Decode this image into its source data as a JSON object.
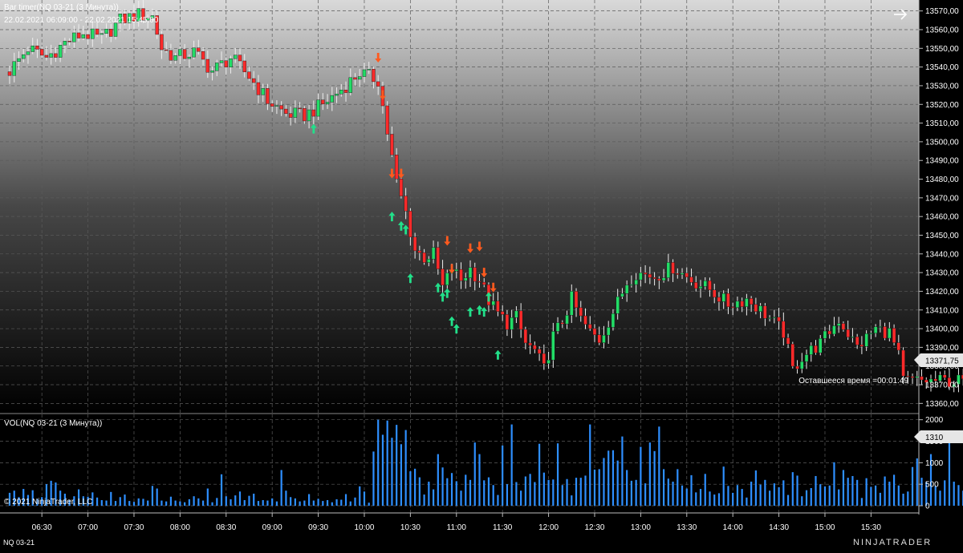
{
  "window": {
    "title": "Bar timer(NQ 03-21 (3 Минута))",
    "range": "22.02.2021 06:09:00 - 22.02.2021 15:45:00",
    "remaining_time": "Оставшееся время =00:01:49",
    "copyright": "© 2021 NinjaTrader, LLC",
    "instrument_tab": "NQ 03-21",
    "brand": "NINJATRADER",
    "colors": {
      "up": "#22dd66",
      "down": "#ff2a2a",
      "arrow_up": "#22e08a",
      "arrow_down": "#ff5a1e",
      "volume": "#2e8fff",
      "grid": "#5a5a5a"
    }
  },
  "chart_data": [
    {
      "type": "candlestick",
      "title": "Bar timer(NQ 03-21 (3 Минута))",
      "subtitle": "22.02.2021 06:09:00 - 22.02.2021 15:45:00",
      "ylim": [
        13355,
        13575
      ],
      "y_ticks": [
        "13570,00",
        "13560,00",
        "13550,00",
        "13540,00",
        "13530,00",
        "13520,00",
        "13510,00",
        "13500,00",
        "13490,00",
        "13480,00",
        "13470,00",
        "13460,00",
        "13450,00",
        "13440,00",
        "13430,00",
        "13420,00",
        "13410,00",
        "13400,00",
        "13390,00",
        "13380,00",
        "13370,00",
        "13360,00"
      ],
      "last_price_label": "13371,75",
      "last_price": 13371.75,
      "grid": true,
      "x_ticks": [
        "06:30",
        "07:00",
        "07:30",
        "08:00",
        "08:30",
        "09:00",
        "09:30",
        "10:00",
        "10:30",
        "11:00",
        "11:30",
        "12:00",
        "12:30",
        "13:00",
        "13:30",
        "14:00",
        "14:30",
        "15:00",
        "15:30"
      ],
      "x_tick_bars": [
        7,
        17,
        27,
        37,
        47,
        57,
        67,
        77,
        87,
        97,
        107,
        117,
        127,
        137,
        147,
        157,
        167,
        177,
        187
      ],
      "close_points": [
        [
          0,
          13538
        ],
        [
          4,
          13550
        ],
        [
          8,
          13545
        ],
        [
          12,
          13553
        ],
        [
          16,
          13558
        ],
        [
          20,
          13555
        ],
        [
          24,
          13565
        ],
        [
          28,
          13568
        ],
        [
          31,
          13567
        ],
        [
          33,
          13550
        ],
        [
          36,
          13545
        ],
        [
          40,
          13548
        ],
        [
          44,
          13538
        ],
        [
          48,
          13545
        ],
        [
          52,
          13535
        ],
        [
          56,
          13522
        ],
        [
          60,
          13515
        ],
        [
          64,
          13514
        ],
        [
          68,
          13520
        ],
        [
          72,
          13528
        ],
        [
          76,
          13537
        ],
        [
          80,
          13533
        ],
        [
          82,
          13505
        ],
        [
          84,
          13478
        ],
        [
          86,
          13462
        ],
        [
          88,
          13442
        ],
        [
          90,
          13438
        ],
        [
          92,
          13440
        ],
        [
          94,
          13422
        ],
        [
          96,
          13432
        ],
        [
          98,
          13426
        ],
        [
          100,
          13432
        ],
        [
          102,
          13426
        ],
        [
          104,
          13415
        ],
        [
          106,
          13408
        ],
        [
          108,
          13403
        ],
        [
          110,
          13406
        ],
        [
          112,
          13392
        ],
        [
          114,
          13388
        ],
        [
          116,
          13378
        ],
        [
          118,
          13396
        ],
        [
          120,
          13404
        ],
        [
          122,
          13416
        ],
        [
          124,
          13405
        ],
        [
          126,
          13398
        ],
        [
          128,
          13394
        ],
        [
          130,
          13404
        ],
        [
          132,
          13414
        ],
        [
          134,
          13425
        ],
        [
          136,
          13430
        ],
        [
          140,
          13428
        ],
        [
          144,
          13433
        ],
        [
          148,
          13426
        ],
        [
          152,
          13421
        ],
        [
          156,
          13413
        ],
        [
          160,
          13416
        ],
        [
          164,
          13408
        ],
        [
          168,
          13398
        ],
        [
          170,
          13378
        ],
        [
          172,
          13385
        ],
        [
          176,
          13392
        ],
        [
          180,
          13405
        ],
        [
          184,
          13390
        ],
        [
          188,
          13400
        ],
        [
          191,
          13398
        ],
        [
          193,
          13385
        ],
        [
          194,
          13372
        ]
      ],
      "signal_arrows": [
        {
          "type": "up",
          "bar": 66,
          "price": 13507
        },
        {
          "type": "down",
          "bar": 80,
          "price": 13545
        },
        {
          "type": "down",
          "bar": 81,
          "price": 13525
        },
        {
          "type": "down",
          "bar": 83,
          "price": 13483
        },
        {
          "type": "down",
          "bar": 85,
          "price": 13483
        },
        {
          "type": "up",
          "bar": 83,
          "price": 13460
        },
        {
          "type": "up",
          "bar": 85,
          "price": 13455
        },
        {
          "type": "up",
          "bar": 86,
          "price": 13453
        },
        {
          "type": "up",
          "bar": 87,
          "price": 13427
        },
        {
          "type": "down",
          "bar": 95,
          "price": 13447
        },
        {
          "type": "down",
          "bar": 96,
          "price": 13432
        },
        {
          "type": "up",
          "bar": 93,
          "price": 13422
        },
        {
          "type": "up",
          "bar": 96,
          "price": 13404
        },
        {
          "type": "up",
          "bar": 97,
          "price": 13400
        },
        {
          "type": "down",
          "bar": 100,
          "price": 13443
        },
        {
          "type": "down",
          "bar": 102,
          "price": 13444
        },
        {
          "type": "down",
          "bar": 103,
          "price": 13430
        },
        {
          "type": "down",
          "bar": 105,
          "price": 13422
        },
        {
          "type": "up",
          "bar": 100,
          "price": 13409
        },
        {
          "type": "up",
          "bar": 102,
          "price": 13410
        },
        {
          "type": "up",
          "bar": 104,
          "price": 13417
        },
        {
          "type": "up",
          "bar": 103,
          "price": 13409
        },
        {
          "type": "up",
          "bar": 106,
          "price": 13386
        },
        {
          "type": "up",
          "bar": 94,
          "price": 13417
        },
        {
          "type": "up",
          "bar": 95,
          "price": 13419
        }
      ]
    },
    {
      "type": "bar",
      "title": "VOL(NQ 03-21 (3 Минута))",
      "ylim": [
        0,
        2050
      ],
      "y_ticks": [
        "2000",
        "1500",
        "1000",
        "500",
        "0"
      ],
      "last_value_label": "1310",
      "last_value": 1310,
      "values": [
        300,
        350,
        200,
        390,
        250,
        360,
        160,
        200,
        500,
        580,
        540,
        350,
        280,
        140,
        220,
        380,
        220,
        210,
        310,
        190,
        130,
        120,
        320,
        110,
        200,
        260,
        110,
        90,
        170,
        160,
        120,
        460,
        400,
        120,
        100,
        210,
        120,
        100,
        80,
        150,
        220,
        170,
        120,
        400,
        80,
        180,
        730,
        220,
        150,
        240,
        330,
        130,
        230,
        280,
        110,
        130,
        120,
        170,
        100,
        830,
        350,
        200,
        170,
        100,
        120,
        270,
        120,
        160,
        110,
        130,
        80,
        150,
        140,
        270,
        100,
        190,
        450,
        330,
        70,
        1260,
        2000,
        1650,
        1980,
        1580,
        1880,
        1430,
        1760,
        800,
        860,
        660,
        260,
        560,
        380,
        1200,
        890,
        640,
        760,
        570,
        350,
        720,
        600,
        1470,
        1200,
        590,
        660,
        480,
        250,
        1400,
        500,
        1890,
        550,
        350,
        680,
        740,
        550,
        1440,
        770,
        600,
        610,
        1450,
        480,
        620,
        240,
        650,
        650,
        700,
        1890,
        840,
        850,
        1110,
        1280,
        1290,
        1050,
        1610,
        830,
        580,
        600,
        1370,
        520,
        1470,
        1270,
        1840,
        850,
        630,
        560,
        850,
        470,
        400,
        710,
        310,
        390,
        740,
        330,
        260,
        290,
        910,
        460,
        300,
        480,
        390,
        190,
        560,
        820,
        490,
        600,
        350,
        520,
        430,
        590,
        250,
        780,
        700,
        220,
        360,
        410,
        690,
        500,
        450,
        470,
        1010,
        380,
        830,
        650,
        690,
        600,
        180,
        640,
        440,
        470,
        300,
        680,
        560,
        720,
        470,
        280,
        330,
        900,
        1100,
        650,
        550,
        1200,
        460,
        350,
        590,
        1710,
        560,
        480,
        350,
        540,
        510,
        730,
        420,
        500,
        630,
        460,
        460,
        670,
        920,
        810,
        1110,
        690,
        580,
        520,
        560,
        1300,
        500,
        670,
        620,
        330,
        460,
        320,
        410,
        460,
        350,
        1310
      ]
    }
  ]
}
